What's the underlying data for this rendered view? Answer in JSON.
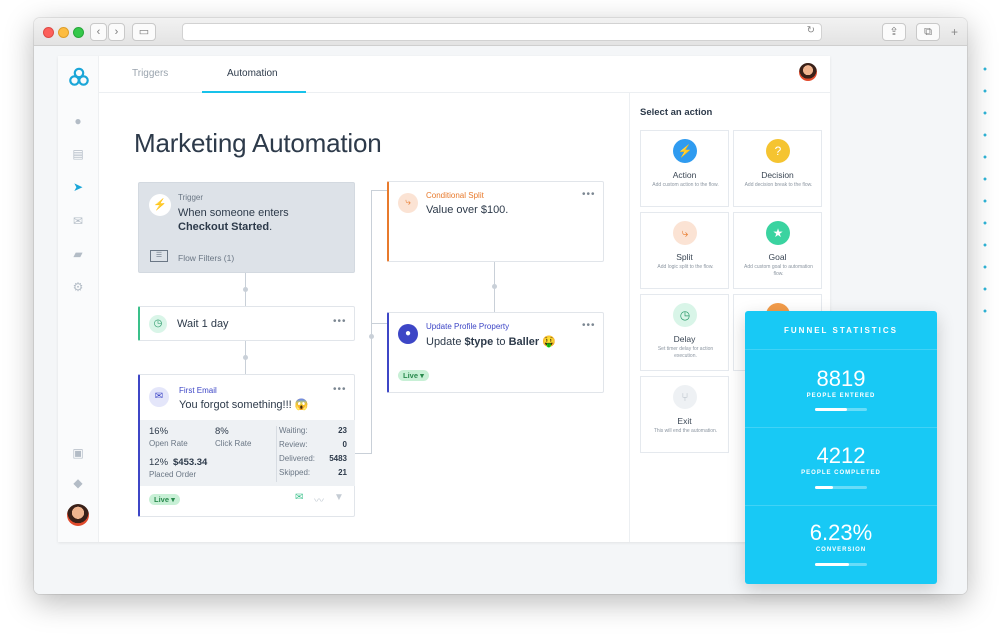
{
  "tabs": [
    "Triggers",
    "Automation"
  ],
  "page_title": "Marketing Automation",
  "trigger": {
    "title": "Trigger",
    "line1": "When someone enters",
    "line2": "Checkout Started",
    "line2_suffix": ".",
    "filters": "Flow Filters (1)"
  },
  "wait": {
    "label": "Wait 1 day"
  },
  "email": {
    "title": "First Email",
    "subject": "You forgot something!!! 😱",
    "open_rate": "16%",
    "open_rate_label": "Open Rate",
    "click_rate": "8%",
    "click_rate_label": "Click Rate",
    "placed_pct": "12%",
    "placed_value": "$453.34",
    "placed_label": "Placed Order",
    "stats": [
      {
        "k": "Waiting:",
        "v": "23"
      },
      {
        "k": "Review:",
        "v": "0"
      },
      {
        "k": "Delivered:",
        "v": "5483"
      },
      {
        "k": "Skipped:",
        "v": "21"
      }
    ],
    "status": "Live ▾"
  },
  "split": {
    "title": "Conditional Split",
    "label": "Value over $100."
  },
  "profile": {
    "title": "Update Profile Property",
    "prefix": "Update ",
    "type": "$type",
    "mid": " to ",
    "value": "Baller",
    "emoji": " 🤑",
    "status": "Live ▾"
  },
  "panel": {
    "title": "Select an action",
    "actions": [
      {
        "name": "Action",
        "desc": "Add custom action to the flow.",
        "color": "#2f9bf0",
        "icon": "⚡"
      },
      {
        "name": "Decision",
        "desc": "Add decision break to the flow.",
        "color": "#f5c431",
        "icon": "?"
      },
      {
        "name": "Split",
        "desc": "Add logic split to the flow.",
        "color": "#fbe3d4",
        "icon": "⤷"
      },
      {
        "name": "Goal",
        "desc": "Add custom goal to automation flow.",
        "color": "#3ad3a0",
        "icon": "★"
      },
      {
        "name": "Delay",
        "desc": "Set timer delay for action execution.",
        "color": "#d9f5e8",
        "icon": "◷"
      },
      {
        "name": "Exit",
        "desc": "This will end the automation.",
        "color": "#eef1f4",
        "icon": "⑂"
      }
    ]
  },
  "funnel": {
    "title": "FUNNEL STATISTICS",
    "stats": [
      {
        "value": "8819",
        "label": "PEOPLE ENTERED",
        "fill": 0.62
      },
      {
        "value": "4212",
        "label": "PEOPLE COMPLETED",
        "fill": 0.35
      },
      {
        "value": "6.23%",
        "label": "CONVERSION",
        "fill": 0.65
      }
    ]
  }
}
